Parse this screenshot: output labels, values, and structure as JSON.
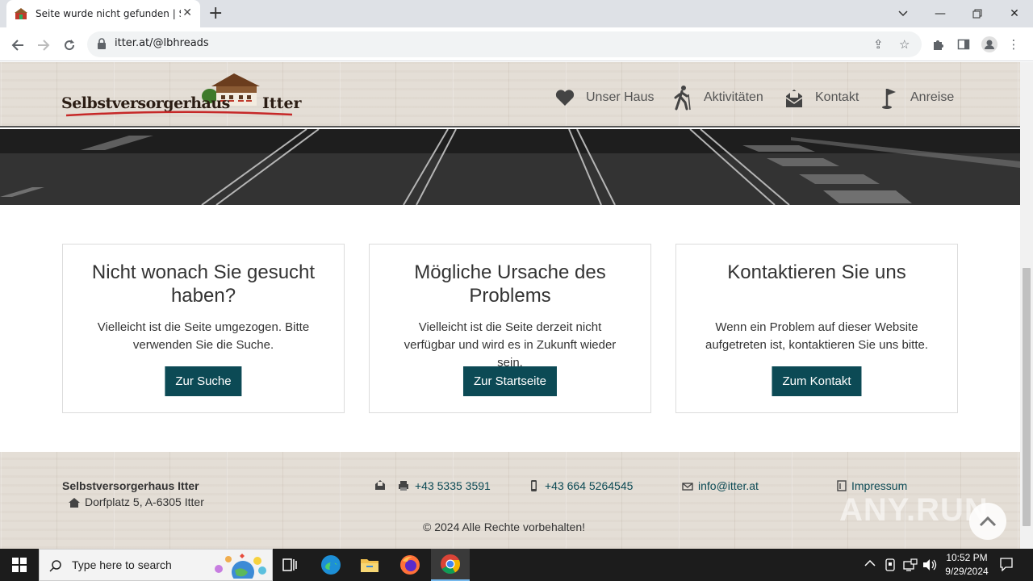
{
  "browser": {
    "tab_title": "Seite wurde nicht gefunden | Sel",
    "url": "itter.at/@lbhreads"
  },
  "site": {
    "logo_text_1": "Selbstversorgerhaus",
    "logo_text_2": "Itter",
    "nav": [
      {
        "label": "Unser Haus",
        "icon": "heart-icon"
      },
      {
        "label": "Aktivitäten",
        "icon": "hiker-icon"
      },
      {
        "label": "Kontakt",
        "icon": "mail-icon"
      },
      {
        "label": "Anreise",
        "icon": "flag-icon"
      }
    ]
  },
  "cards": [
    {
      "title": "Nicht wonach Sie gesucht haben?",
      "text": "Vielleicht ist die Seite umgezogen. Bitte verwenden Sie die Suche.",
      "button": "Zur Suche"
    },
    {
      "title": "Mögliche Ursache des Problems",
      "text": "Vielleicht ist die Seite derzeit nicht verfügbar und wird es in Zukunft wieder sein.",
      "button": "Zur Startseite"
    },
    {
      "title": "Kontaktieren Sie uns",
      "text": "Wenn ein Problem auf dieser Website aufgetreten ist, kontaktieren Sie uns bitte.",
      "button": "Zum Kontakt"
    }
  ],
  "footer": {
    "name": "Selbstversorgerhaus Itter",
    "address": "Dorfplatz 5, A-6305 Itter",
    "phone": "+43 5335 3591",
    "mobile": "+43 664 5264545",
    "email": "info@itter.at",
    "impressum": "Impressum",
    "copyright": "© 2024 Alle Rechte vorbehalten!"
  },
  "watermark": "ANY.RUN",
  "taskbar": {
    "search_placeholder": "Type here to search",
    "time": "10:52 PM",
    "date": "9/29/2024"
  },
  "colors": {
    "button_bg": "#0c4a55",
    "link": "#0c4a55"
  }
}
